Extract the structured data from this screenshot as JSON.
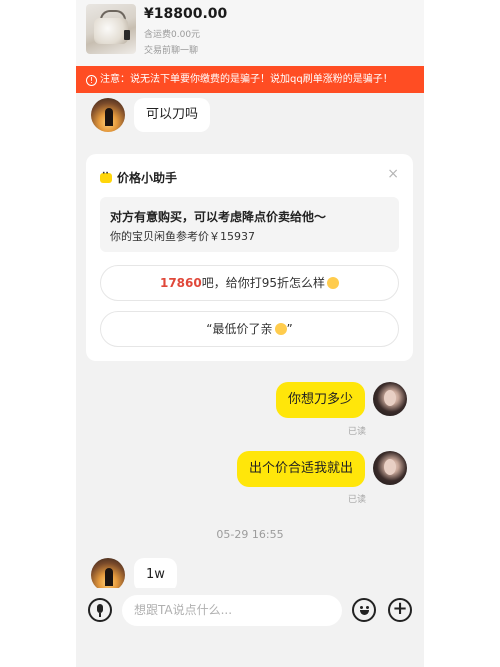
{
  "product": {
    "price": "¥18800.00",
    "shipping": "含运费0.00元",
    "trade_note": "交易前聊一聊",
    "thumbnail_icon": "handbag-image"
  },
  "warning": {
    "icon": "exclamation-circle-icon",
    "text": "注意：说无法下单要你缴费的是骗子！说加qq刷单涨粉的是骗子！",
    "color": "#ff4d23"
  },
  "messages": {
    "m1": {
      "side": "left",
      "text": "可以刀吗"
    },
    "m2": {
      "side": "right",
      "text": "你想刀多少",
      "status": "已读"
    },
    "m3": {
      "side": "right",
      "text": "出个价合适我就出",
      "status": "已读"
    },
    "m4": {
      "side": "left",
      "text": "1w"
    }
  },
  "helper": {
    "title": "价格小助手",
    "close_icon": "×",
    "offer_line1": "对方有意购买，可以考虑降点价卖给他～",
    "offer_line2": "你的宝贝闲鱼参考价￥15937",
    "reply1_price": "17860",
    "reply1_rest": "吧，给你打95折怎么样",
    "reply2": "“最低价了亲",
    "reply2_end": "”"
  },
  "timestamp": "05-29 16:55",
  "input": {
    "placeholder": "想跟TA说点什么...",
    "plus": "+"
  },
  "colors": {
    "accent_yellow": "#ffe60a",
    "warning_red": "#ff4d23",
    "background": "#f2f2f2"
  }
}
